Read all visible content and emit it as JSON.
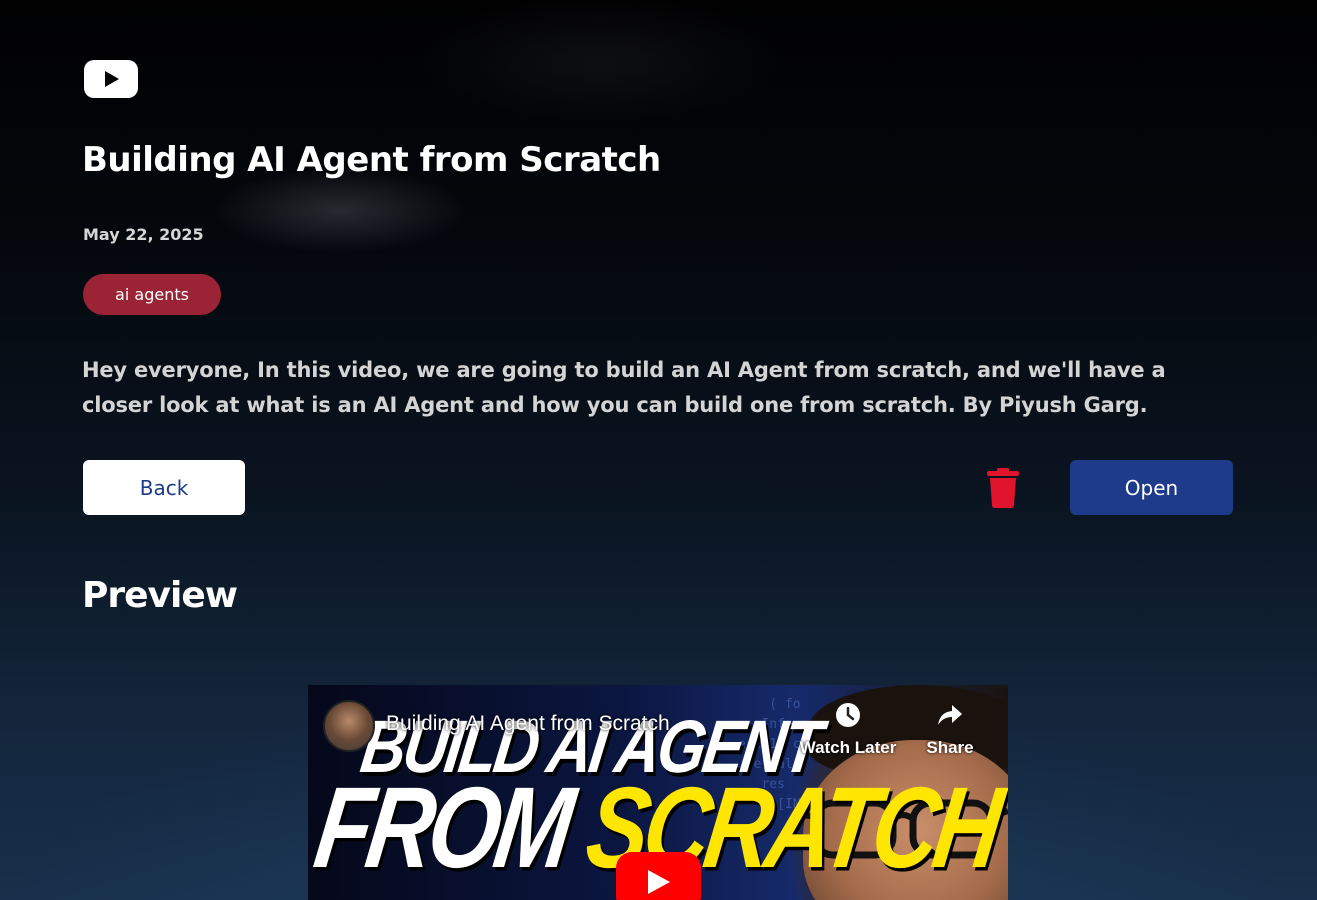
{
  "header": {
    "logo_icon": "youtube-icon",
    "title": "Building AI Agent from Scratch",
    "date": "May 22, 2025",
    "tag": "ai agents"
  },
  "description": "Hey everyone, In this video, we are going to build an AI Agent from scratch, and we'll have a closer look at what is an AI Agent and how you can build one from scratch. By Piyush Garg.",
  "actions": {
    "back_label": "Back",
    "delete_icon": "trash-icon",
    "open_label": "Open"
  },
  "preview": {
    "heading": "Preview",
    "video": {
      "title": "Building AI Agent from Scratch",
      "thumbnail_line1": "BUILD AI AGENT",
      "thumbnail_word1": "FROM",
      "thumbnail_word2": "SCRATCH",
      "watch_later_label": "Watch Later",
      "share_label": "Share"
    }
  },
  "colors": {
    "tag_bg": "#9b2336",
    "open_bg": "#1e3a8a",
    "back_text": "#1e3a8a",
    "delete": "#e0142c"
  }
}
